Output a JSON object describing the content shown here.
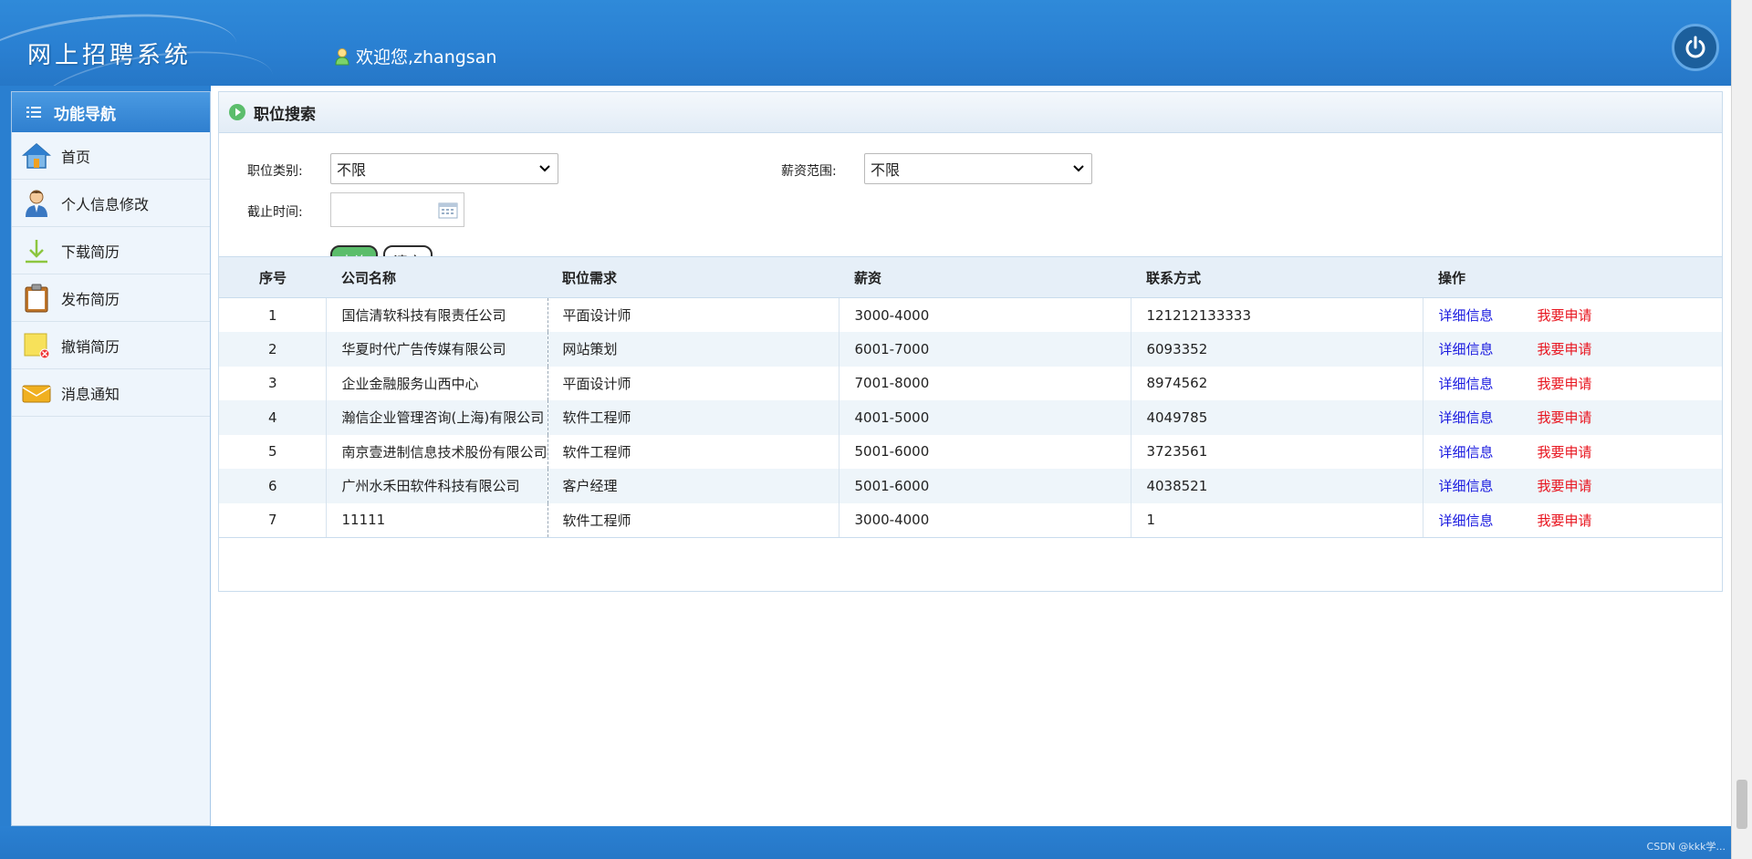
{
  "header": {
    "app_title": "网上招聘系统",
    "welcome_text": "欢迎您,zhangsan"
  },
  "sidebar": {
    "title": "功能导航",
    "items": [
      {
        "label": "首页",
        "icon": "home-icon"
      },
      {
        "label": "个人信息修改",
        "icon": "user-profile-icon"
      },
      {
        "label": "下载简历",
        "icon": "download-icon"
      },
      {
        "label": "发布简历",
        "icon": "clipboard-icon"
      },
      {
        "label": "撤销简历",
        "icon": "note-delete-icon"
      },
      {
        "label": "消息通知",
        "icon": "envelope-icon"
      }
    ]
  },
  "search": {
    "title": "职位搜索",
    "category_label": "职位类别:",
    "category_value": "不限",
    "salary_label": "薪资范围:",
    "salary_value": "不限",
    "deadline_label": "截止时间:",
    "deadline_value": "",
    "query_button": "查询",
    "clear_button": "清空"
  },
  "table": {
    "headers": {
      "no": "序号",
      "company": "公司名称",
      "position": "职位需求",
      "salary": "薪资",
      "contact": "联系方式",
      "operation": "操作"
    },
    "detail_label": "详细信息",
    "apply_label": "我要申请",
    "rows": [
      {
        "no": "1",
        "company": "国信清软科技有限责任公司",
        "position": "平面设计师",
        "salary": "3000-4000",
        "contact": "121212133333"
      },
      {
        "no": "2",
        "company": "华夏时代广告传媒有限公司",
        "position": "网站策划",
        "salary": "6001-7000",
        "contact": "6093352"
      },
      {
        "no": "3",
        "company": "企业金融服务山西中心",
        "position": "平面设计师",
        "salary": "7001-8000",
        "contact": "8974562"
      },
      {
        "no": "4",
        "company": "瀚信企业管理咨询(上海)有限公司",
        "position": "软件工程师",
        "salary": "4001-5000",
        "contact": "4049785"
      },
      {
        "no": "5",
        "company": "南京壹进制信息技术股份有限公司",
        "position": "软件工程师",
        "salary": "5001-6000",
        "contact": "3723561"
      },
      {
        "no": "6",
        "company": "广州水禾田软件科技有限公司",
        "position": "客户经理",
        "salary": "5001-6000",
        "contact": "4038521"
      },
      {
        "no": "7",
        "company": "11111",
        "position": "软件工程师",
        "salary": "3000-4000",
        "contact": "1"
      }
    ]
  },
  "footer": {
    "watermark": "CSDN @kkk学..."
  },
  "colors": {
    "header_blue": "#2a80d2",
    "detail_link": "#1a1adf",
    "apply_link": "#e8141e",
    "query_button": "#5bbd6b"
  }
}
